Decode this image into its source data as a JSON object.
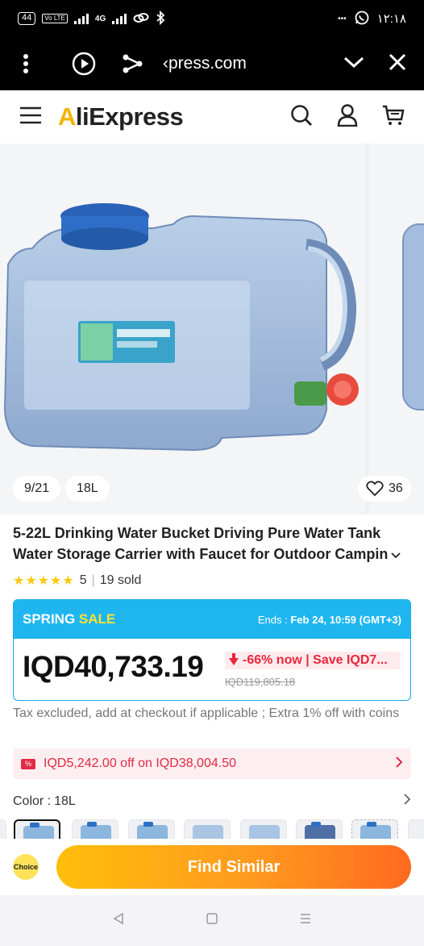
{
  "status_bar": {
    "battery": "44",
    "volte": "Vo LTE",
    "network": "4G",
    "time": "١٢:١٨",
    "dots": "•••"
  },
  "browser": {
    "url": "‹press.com",
    "icons": [
      "menu-dots-icon",
      "play-icon",
      "share-icon",
      "chevron-down-icon",
      "close-icon"
    ]
  },
  "header": {
    "logo_a": "A",
    "logo_rest": "liExpress",
    "icons": [
      "hamburger-icon",
      "search-icon",
      "user-icon",
      "cart-icon"
    ]
  },
  "gallery": {
    "counter": "9/21",
    "variant": "18L",
    "wishlist_count": "36"
  },
  "product": {
    "title_line1": "5-22L Drinking Water Bucket Driving Pure Water Tank",
    "title_line2": "Water Storage Carrier with Faucet for Outdoor Campin",
    "rating": 5,
    "rating_text": "5",
    "sold": "19 sold"
  },
  "sale": {
    "label_a": "SPRING ",
    "label_b": "SALE",
    "ends_label": "Ends :",
    "ends_value": "Feb 24, 10:59 (GMT+3)",
    "price": "IQD40,733.19",
    "discount": "-66% now | Save IQD7...",
    "original_price": "IQD119,805.18"
  },
  "tax_note": "Tax excluded, add at checkout if applicable ; Extra 1% off with coins",
  "coupon": {
    "text": "IQD5,242.00 off on IQD38,004.50"
  },
  "color": {
    "label": "Color :",
    "value": "18L"
  },
  "bottom": {
    "choice_badge": "Choice",
    "find_similar": "Find Similar"
  },
  "colors": {
    "accent_orange": "#ff8a1f",
    "sale_blue": "#1fb6f0",
    "discount_red": "#e8273a",
    "star_yellow": "#f9c90c"
  }
}
